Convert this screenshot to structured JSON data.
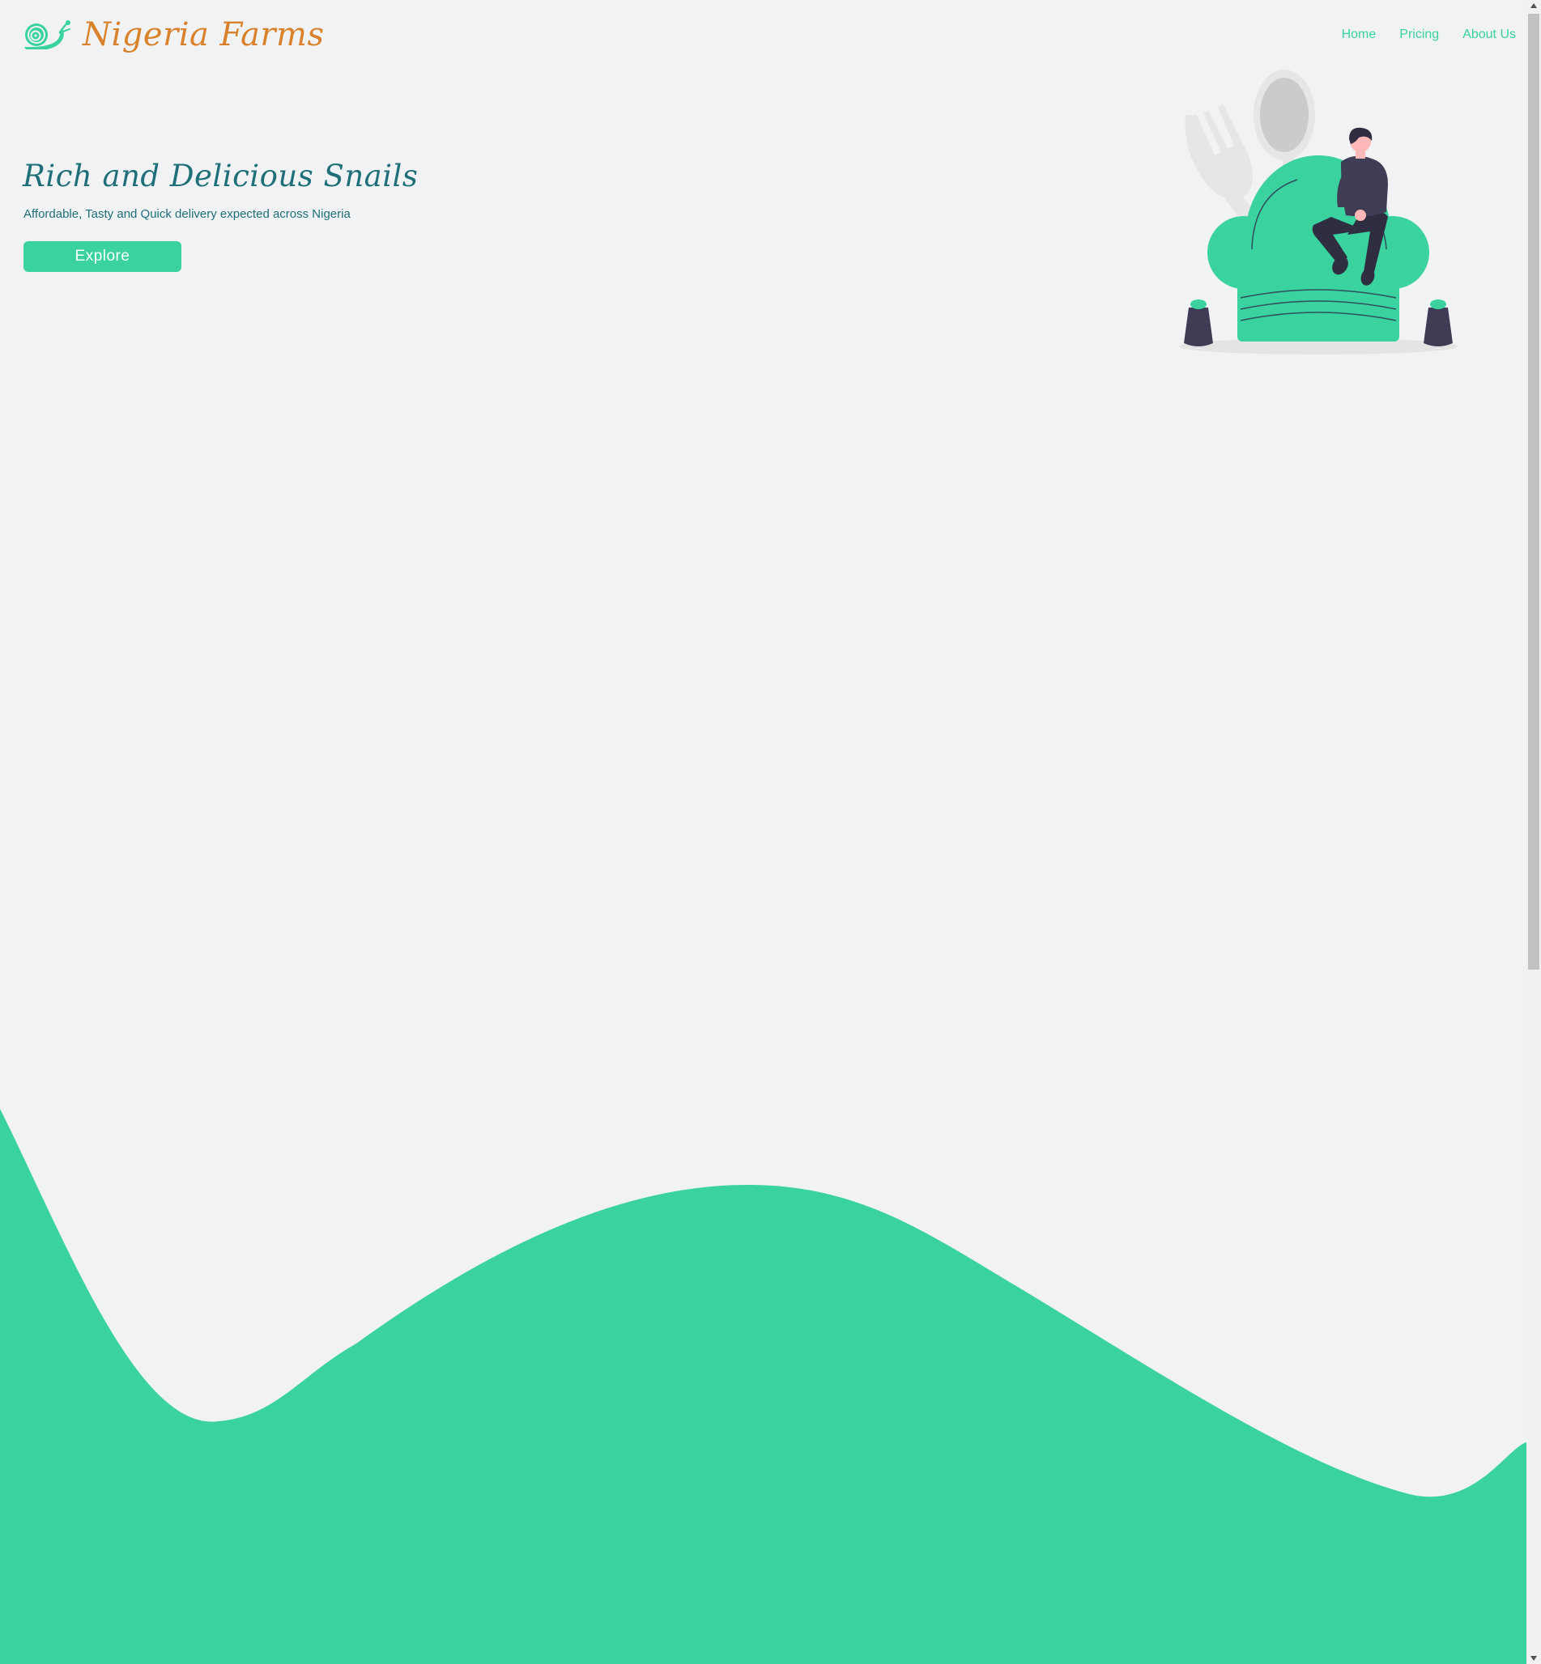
{
  "header": {
    "brand_name": "Nigeria Farms",
    "logo_icon": "snail-icon",
    "nav": {
      "home": "Home",
      "pricing": "Pricing",
      "about": "About Us"
    }
  },
  "hero": {
    "title": "Rich and Delicious Snails",
    "subtitle": "Affordable, Tasty and Quick delivery expected across Nigeria",
    "button_label": "Explore",
    "illustration_icon": "chef-hat-person-illustration"
  },
  "colors": {
    "accent": "#3ad29f",
    "brand": "#d9812b",
    "heading": "#1e6f78",
    "background": "#f0f2f3",
    "dark_figure": "#3f3d56"
  }
}
